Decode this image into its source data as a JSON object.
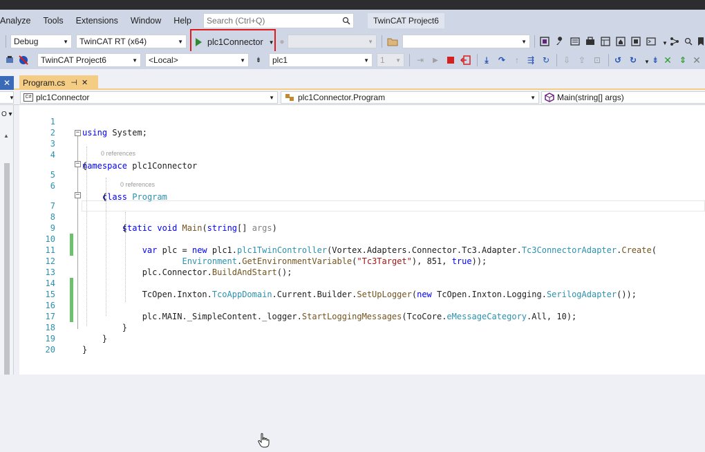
{
  "menubar": {
    "items": [
      "Analyze",
      "Tools",
      "Extensions",
      "Window",
      "Help"
    ],
    "search_placeholder": "Search (Ctrl+Q)",
    "project_name": "TwinCAT Project6"
  },
  "toolbar1": {
    "configuration": "Debug",
    "platform": "TwinCAT RT (x64)",
    "startup_project": "plc1Connector"
  },
  "toolbar2": {
    "project": "TwinCAT Project6",
    "target": "<Local>",
    "plc": "plc1",
    "instance": "1"
  },
  "tabs": [
    {
      "label": "Program.cs",
      "active": true
    }
  ],
  "navbar": {
    "project": "plc1Connector",
    "class": "plc1Connector.Program",
    "member": "Main(string[] args)"
  },
  "editor": {
    "lens_class": "0 references",
    "lens_method": "0 references",
    "line_numbers": [
      "1",
      "2",
      "3",
      "4",
      "5",
      "6",
      "7",
      "8",
      "9",
      "10",
      "11",
      "12",
      "13",
      "14",
      "15",
      "16",
      "17",
      "18",
      "19",
      "20"
    ]
  },
  "colors": {
    "highlight_border": "#e01a1a",
    "active_tab": "#f5cc84",
    "change_bar": "#6cc26c",
    "keyword": "#0000ff",
    "type": "#2b91af"
  }
}
